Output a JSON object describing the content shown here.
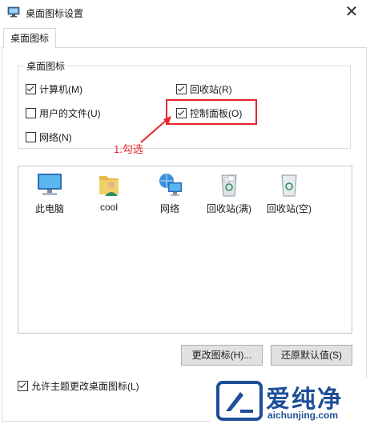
{
  "window": {
    "title": "桌面图标设置",
    "close_glyph": "✕"
  },
  "tab": {
    "label": "桌面图标"
  },
  "group": {
    "legend": "桌面图标",
    "checkboxes": [
      {
        "label": "计算机(M)",
        "checked": true
      },
      {
        "label": "回收站(R)",
        "checked": true
      },
      {
        "label": "用户的文件(U)",
        "checked": false
      },
      {
        "label": "控制面板(O)",
        "checked": true
      },
      {
        "label": "网络(N)",
        "checked": false
      }
    ]
  },
  "annotation": {
    "text": "1.勾选",
    "color": "#e8252b"
  },
  "icons": [
    {
      "name": "此电脑",
      "icon": "computer-icon"
    },
    {
      "name": "cool",
      "icon": "user-folder-icon"
    },
    {
      "name": "网络",
      "icon": "network-icon"
    },
    {
      "name": "回收站(满)",
      "icon": "recycle-bin-full-icon"
    },
    {
      "name": "回收站(空)",
      "icon": "recycle-bin-empty-icon"
    }
  ],
  "buttons": {
    "change_icon": "更改图标(H)...",
    "restore_default": "还原默认值(S)"
  },
  "allow_themes": {
    "label": "允许主题更改桌面图标(L)",
    "checked": true
  },
  "watermark": {
    "text": "爱纯净",
    "url": "aichunjing.com",
    "color": "#1e4e97"
  }
}
